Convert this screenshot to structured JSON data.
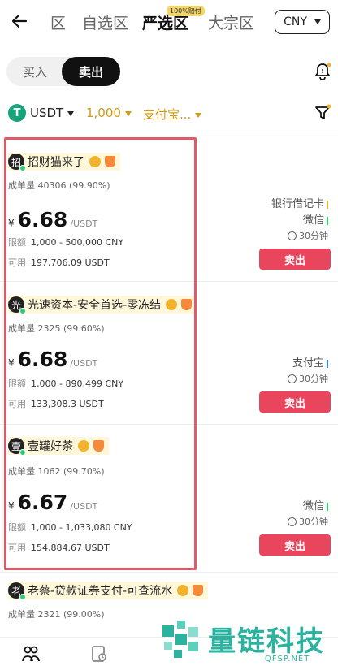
{
  "nav": {
    "tabs": [
      {
        "label": "区"
      },
      {
        "label": "自选区"
      },
      {
        "label": "严选区",
        "badge": "100%赔付"
      },
      {
        "label": "大宗区"
      }
    ],
    "currency": "CNY"
  },
  "toggle": {
    "buy": "买入",
    "sell": "卖出"
  },
  "filters": {
    "coin": "USDT",
    "coin_icon": "T",
    "amount": "1,000",
    "payment": "支付宝..."
  },
  "listings": [
    {
      "avatar": "招",
      "name": "招财猫来了",
      "orders_label": "成单量",
      "orders": "40306 (99.90%)",
      "currency_symbol": "¥",
      "price": "6.68",
      "unit": "/USDT",
      "limit_label": "限额",
      "limit": "1,000 - 500,000 CNY",
      "avail_label": "可用",
      "avail": "197,706.09 USDT",
      "payments": [
        {
          "name": "银行借记卡",
          "color": "#f1b32e"
        },
        {
          "name": "微信",
          "color": "#2ecc71"
        }
      ],
      "time": "30分钟",
      "action": "卖出"
    },
    {
      "avatar": "光",
      "name": "光速资本-安全首选-零冻结",
      "orders_label": "成单量",
      "orders": "2325 (99.60%)",
      "currency_symbol": "¥",
      "price": "6.68",
      "unit": "/USDT",
      "limit_label": "限额",
      "limit": "1,000 - 890,499 CNY",
      "avail_label": "可用",
      "avail": "133,308.3 USDT",
      "payments": [
        {
          "name": "支付宝",
          "color": "#3a8de8"
        }
      ],
      "time": "30分钟",
      "action": "卖出"
    },
    {
      "avatar": "壹",
      "name": "壹罐好茶",
      "orders_label": "成单量",
      "orders": "1062 (99.70%)",
      "currency_symbol": "¥",
      "price": "6.67",
      "unit": "/USDT",
      "limit_label": "限额",
      "limit": "1,000 - 1,033,080 CNY",
      "avail_label": "可用",
      "avail": "154,884.67 USDT",
      "payments": [
        {
          "name": "微信",
          "color": "#2ecc71"
        }
      ],
      "time": "30分钟",
      "action": "卖出"
    },
    {
      "avatar": "老",
      "name": "老蔡-贷款证券支付-可查流水",
      "orders_label": "成单量",
      "orders": "2321 (99.00%)"
    }
  ],
  "watermark": {
    "text": "量链科技",
    "sub": "QFSP.NET"
  },
  "colors": {
    "accent": "#e9465e",
    "gold": "#d19a12",
    "highlight": "#e05a6a"
  }
}
